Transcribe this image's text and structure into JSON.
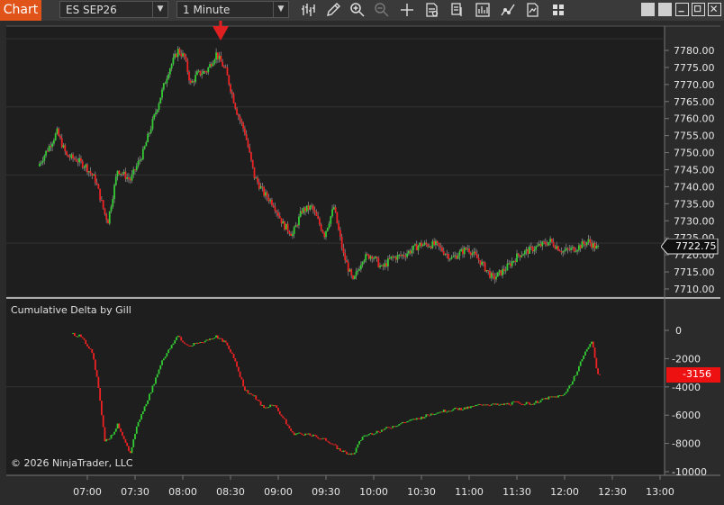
{
  "window": {
    "tab_label": "Chart",
    "instrument": "ES SEP26",
    "interval": "1 Minute"
  },
  "toolbar_icons": [
    "bar-style-icon",
    "draw-pencil-icon",
    "zoom-in-icon",
    "zoom-out-icon",
    "crosshair-icon",
    "properties-icon",
    "data-box-icon",
    "indicators-icon",
    "strategies-icon",
    "templates-icon",
    "grid-icon"
  ],
  "price_panel": {
    "y_ticks": [
      "7780.00",
      "7775.00",
      "7770.00",
      "7765.00",
      "7760.00",
      "7755.00",
      "7750.00",
      "7745.00",
      "7740.00",
      "7735.00",
      "7730.00",
      "7725.00",
      "7720.00",
      "7715.00",
      "7710.00"
    ],
    "last_price": "7722.75"
  },
  "delta_panel": {
    "label": "Cumulative Delta by Gill",
    "y_ticks": [
      "0",
      "-2000",
      "-4000",
      "-6000",
      "-8000",
      "-10000"
    ],
    "last_value": "-3156"
  },
  "x_ticks": [
    "07:00",
    "07:30",
    "08:00",
    "08:30",
    "09:00",
    "09:30",
    "10:00",
    "10:30",
    "11:00",
    "11:30",
    "12:00",
    "12:30",
    "13:00"
  ],
  "copyright": "© 2026 NinjaTrader, LLC",
  "colors": {
    "up": "#33cc33",
    "down": "#ee2222",
    "arrow": "#e02020",
    "accent": "#e0541a"
  }
}
